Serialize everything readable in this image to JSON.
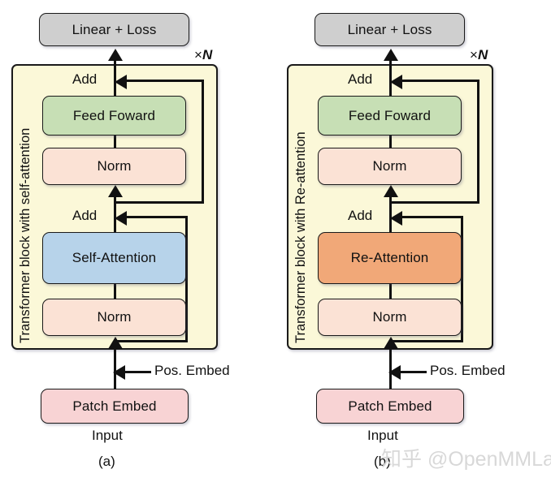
{
  "figure": {
    "watermark": "知乎 @OpenMMLab"
  },
  "panels": [
    {
      "id": "a",
      "caption": "(a)",
      "head_box": "Linear + Loss",
      "repeat_label": "×N",
      "block_label": "Transformer block with self-attention",
      "add_top": "Add",
      "feedforward": "Feed Foward",
      "norm_top": "Norm",
      "add_bottom": "Add",
      "attention": "Self-Attention",
      "norm_bottom": "Norm",
      "pos_embed": "Pos. Embed",
      "patch_embed": "Patch Embed",
      "input": "Input"
    },
    {
      "id": "b",
      "caption": "(b)",
      "head_box": "Linear + Loss",
      "repeat_label": "×N",
      "block_label": "Transformer block with Re-attention",
      "add_top": "Add",
      "feedforward": "Feed Foward",
      "norm_top": "Norm",
      "add_bottom": "Add",
      "attention": "Re-Attention",
      "norm_bottom": "Norm",
      "pos_embed": "Pos. Embed",
      "patch_embed": "Patch Embed",
      "input": "Input"
    }
  ],
  "colors": {
    "linear_loss": "#cfcfcf",
    "feed_forward": "#c7dfb5",
    "norm": "#fbe2d5",
    "self_attention": "#b7d3ea",
    "re_attention": "#f1a878",
    "patch_embed": "#f8d3d4",
    "block_background": "#fbf8d8",
    "stroke": "#1a1a1a"
  }
}
